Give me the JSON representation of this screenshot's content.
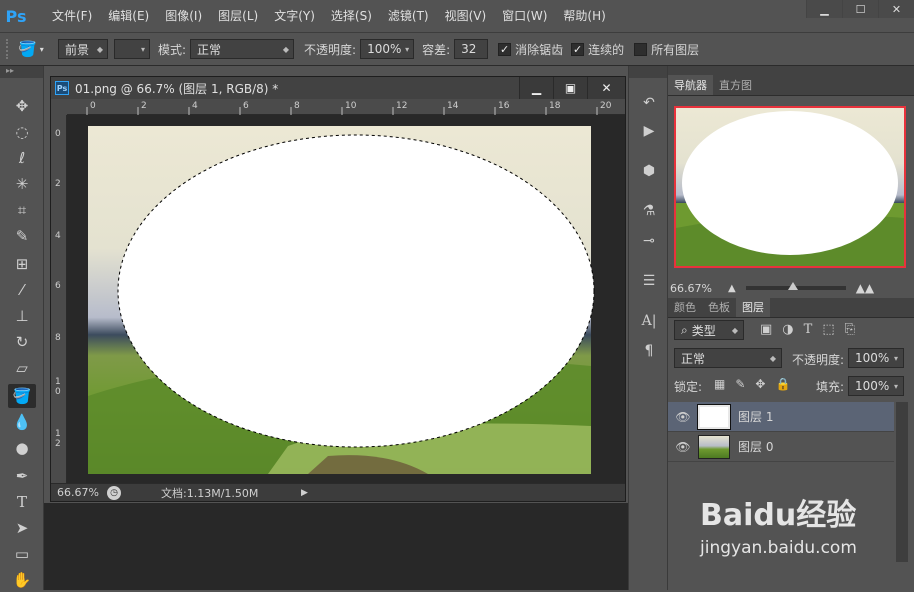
{
  "app": {
    "logo": "Ps"
  },
  "menu": [
    "文件(F)",
    "编辑(E)",
    "图像(I)",
    "图层(L)",
    "文字(Y)",
    "选择(S)",
    "滤镜(T)",
    "视图(V)",
    "窗口(W)",
    "帮助(H)"
  ],
  "options": {
    "fill_source": "前景",
    "mode_label": "模式:",
    "mode_value": "正常",
    "opacity_label": "不透明度:",
    "opacity_value": "100%",
    "tolerance_label": "容差:",
    "tolerance_value": "32",
    "antialias_label": "消除锯齿",
    "contiguous_label": "连续的",
    "all_layers_label": "所有图层"
  },
  "document": {
    "title": "01.png @ 66.7% (图层 1, RGB/8) *",
    "ruler_top": [
      "0",
      "2",
      "4",
      "6",
      "8",
      "10",
      "12",
      "14",
      "16",
      "18",
      "20"
    ],
    "ruler_left": [
      "0",
      "2",
      "4",
      "6",
      "8",
      "1\n0",
      "1\n2"
    ],
    "zoom": "66.67%",
    "doc_info": "文档:1.13M/1.50M"
  },
  "panels": {
    "nav_tabs": [
      "导航器",
      "直方图"
    ],
    "nav_zoom": "66.67%",
    "layer_tabs": [
      "颜色",
      "色板",
      "图层"
    ],
    "filter_label": "类型",
    "blend_mode": "正常",
    "opacity_label": "不透明度:",
    "opacity_value": "100%",
    "lock_label": "锁定:",
    "fill_label": "填充:",
    "fill_value": "100%",
    "layers": [
      {
        "name": "图层 1"
      },
      {
        "name": "图层 0"
      }
    ]
  },
  "watermark": {
    "brand": "Baidu经验",
    "url": "jingyan.baidu.com"
  }
}
